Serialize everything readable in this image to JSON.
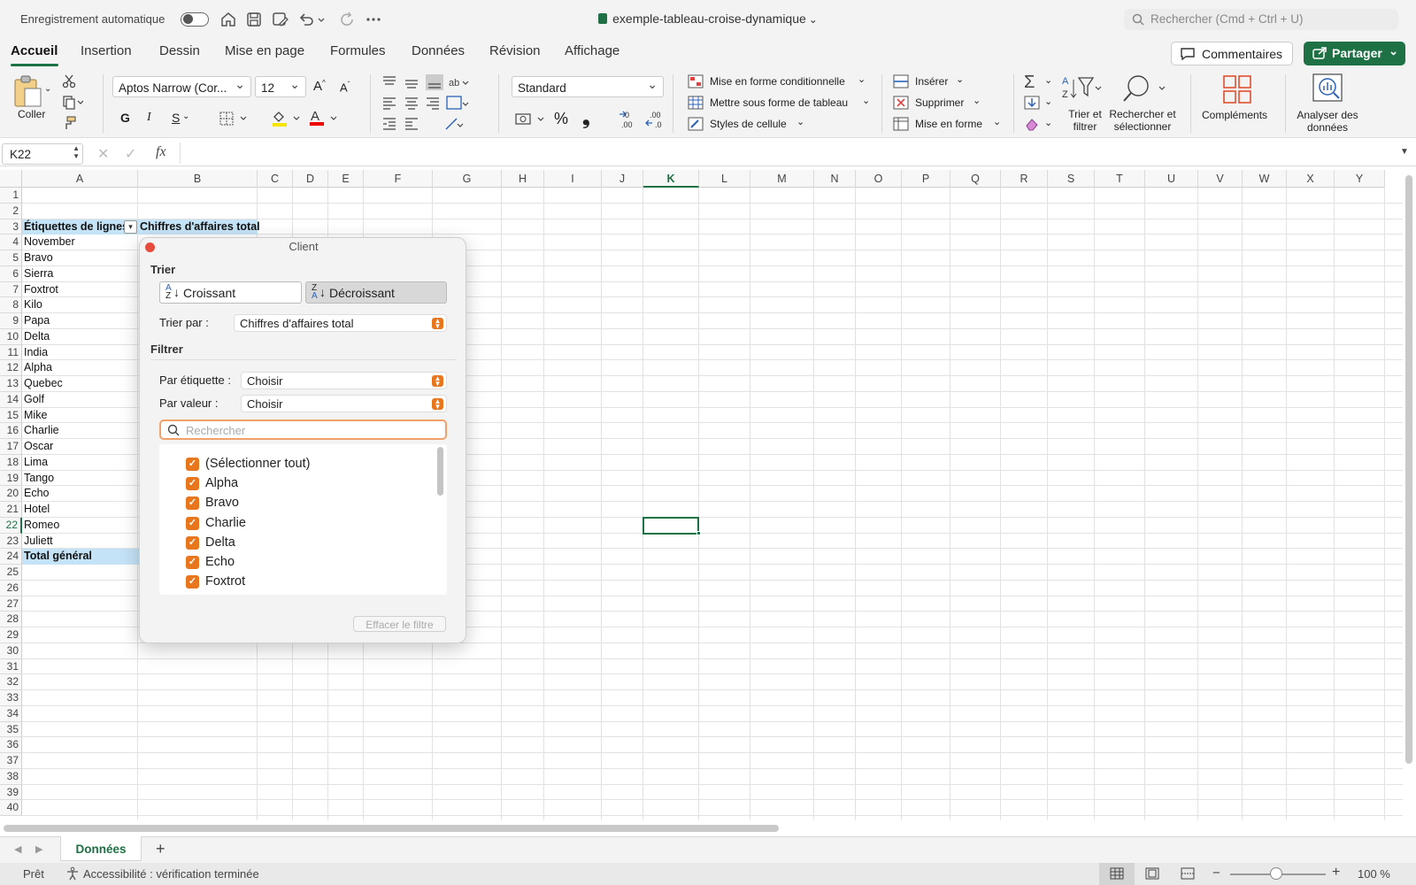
{
  "titlebar": {
    "autosave_label": "Enregistrement automatique",
    "document_title": "exemple-tableau-croise-dynamique",
    "search_placeholder": "Rechercher (Cmd + Ctrl + U)"
  },
  "menu": {
    "tabs": [
      "Accueil",
      "Insertion",
      "Dessin",
      "Mise en page",
      "Formules",
      "Données",
      "Révision",
      "Affichage"
    ],
    "active_tab": "Accueil",
    "comments_label": "Commentaires",
    "share_label": "Partager"
  },
  "ribbon": {
    "paste_label": "Coller",
    "font_name": "Aptos Narrow (Cor...",
    "font_size": "12",
    "bold": "G",
    "italic": "I",
    "underline": "S",
    "number_format": "Standard",
    "percent": "%",
    "comma": "❟",
    "conditional_format": "Mise en forme conditionnelle",
    "format_as_table": "Mettre sous forme de tableau",
    "cell_styles": "Styles de cellule",
    "insert": "Insérer",
    "delete": "Supprimer",
    "format": "Mise en forme",
    "sort_filter": "Trier et filtrer",
    "find_select": "Rechercher et sélectionner",
    "addins": "Compléments",
    "analyze_data": "Analyser des données"
  },
  "formula_bar": {
    "name_box": "K22",
    "fx": "fx",
    "formula": ""
  },
  "grid": {
    "columns": [
      "A",
      "B",
      "C",
      "D",
      "E",
      "F",
      "G",
      "H",
      "I",
      "J",
      "K",
      "L",
      "M",
      "N",
      "O",
      "P",
      "Q",
      "R",
      "S",
      "T",
      "U",
      "V",
      "W",
      "X",
      "Y"
    ],
    "rows": [
      "1",
      "2",
      "3",
      "4",
      "5",
      "6",
      "7",
      "8",
      "9",
      "10",
      "11",
      "12",
      "13",
      "14",
      "15",
      "16",
      "17",
      "18",
      "19",
      "20",
      "21",
      "22",
      "23",
      "24",
      "25",
      "26",
      "27",
      "28",
      "29",
      "30",
      "31",
      "32",
      "33",
      "34",
      "35",
      "36",
      "37",
      "38",
      "39",
      "40"
    ],
    "selected_cell": "K22",
    "pivot_header_labels": "Étiquettes de lignes",
    "pivot_header_values": "Chiffres d'affaires total",
    "pivot_rows": [
      "November",
      "Bravo",
      "Sierra",
      "Foxtrot",
      "Kilo",
      "Papa",
      "Delta",
      "India",
      "Alpha",
      "Quebec",
      "Golf",
      "Mike",
      "Charlie",
      "Oscar",
      "Lima",
      "Tango",
      "Echo",
      "Hotel",
      "Romeo",
      "Juliett"
    ],
    "grand_total_label": "Total général"
  },
  "filter_popup": {
    "title": "Client",
    "sort_heading": "Trier",
    "ascending": "Croissant",
    "descending": "Décroissant",
    "sort_by_label": "Trier par :",
    "sort_by_value": "Chiffres d'affaires total",
    "filter_heading": "Filtrer",
    "by_label_label": "Par étiquette :",
    "by_label_value": "Choisir",
    "by_value_label": "Par valeur :",
    "by_value_value": "Choisir",
    "search_placeholder": "Rechercher",
    "items": [
      "(Sélectionner tout)",
      "Alpha",
      "Bravo",
      "Charlie",
      "Delta",
      "Echo",
      "Foxtrot"
    ],
    "clear_filter": "Effacer le filtre"
  },
  "sheets": {
    "tabs": [
      "Données"
    ],
    "add": "+"
  },
  "status": {
    "ready": "Prêt",
    "accessibility": "Accessibilité : vérification terminée",
    "zoom": "100 %"
  },
  "colors": {
    "accent": "#1e7145",
    "pivot_header": "#c5e3f6",
    "checkbox": "#e8761d"
  }
}
